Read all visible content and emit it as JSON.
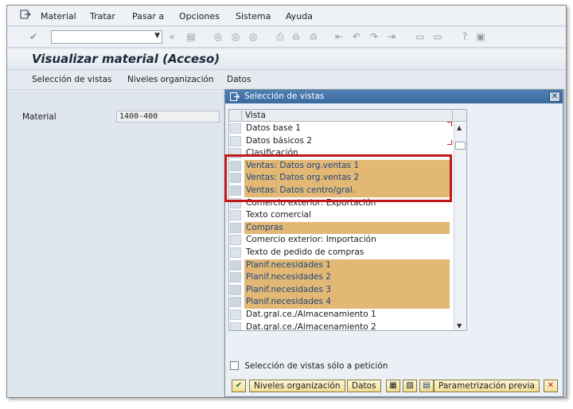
{
  "menubar": {
    "items": [
      {
        "label": "Material"
      },
      {
        "label": "Tratar"
      },
      {
        "label": "Pasar a"
      },
      {
        "label": "Opciones"
      },
      {
        "label": "Sistema"
      },
      {
        "label": "Ayuda"
      }
    ]
  },
  "toolbar": {
    "command_value": "",
    "icons": [
      "check-icon",
      "save-icon",
      "back-icon",
      "exit-icon",
      "cancel-icon",
      "print-icon",
      "find-icon",
      "find-next-icon",
      "first-page-icon",
      "prev-page-icon",
      "next-page-icon",
      "last-page-icon",
      "new-session-icon",
      "shortcut-icon",
      "help-icon",
      "layout-icon"
    ]
  },
  "screen": {
    "title": "Visualizar material (Acceso)"
  },
  "appbar": {
    "buttons": [
      "Selección de vistas",
      "Niveles organización",
      "Datos"
    ]
  },
  "form": {
    "material_label": "Material",
    "material_value": "1400-400"
  },
  "dialog": {
    "title": "Selección de vistas",
    "column_header": "Vista",
    "rows": [
      {
        "label": "Datos base 1",
        "selected": false
      },
      {
        "label": "Datos básicos 2",
        "selected": false
      },
      {
        "label": "Clasificación",
        "selected": false
      },
      {
        "label": "Ventas: Datos org.ventas 1",
        "selected": true
      },
      {
        "label": "Ventas: Datos org.ventas 2",
        "selected": true
      },
      {
        "label": "Ventas: Datos centro/gral.",
        "selected": true
      },
      {
        "label": "Comercio exterior: Exportación",
        "selected": false
      },
      {
        "label": "Texto comercial",
        "selected": false
      },
      {
        "label": "Compras",
        "selected": true
      },
      {
        "label": "Comercio exterior: Importación",
        "selected": false
      },
      {
        "label": "Texto de pedido de compras",
        "selected": false
      },
      {
        "label": "Planif.necesidades 1",
        "selected": true
      },
      {
        "label": "Planif.necesidades 2",
        "selected": true
      },
      {
        "label": "Planif.necesidades 3",
        "selected": true
      },
      {
        "label": "Planif.necesidades 4",
        "selected": true
      },
      {
        "label": "Dat.gral.ce./Almacenamiento 1",
        "selected": false
      },
      {
        "label": "Dat.gral.ce./Almacenamiento 2",
        "selected": false
      }
    ],
    "checkbox_label": "Selección de vistas sólo a petición",
    "checkbox_checked": false,
    "buttons": {
      "niveles": "Niveles organización",
      "datos": "Datos",
      "parametrizacion": "Parametrización previa"
    }
  },
  "colors": {
    "selected_row": "#e2b874",
    "selected_text": "#1c4480",
    "dialog_title": "#3b6a9f",
    "highlight_frame": "#c01818"
  }
}
